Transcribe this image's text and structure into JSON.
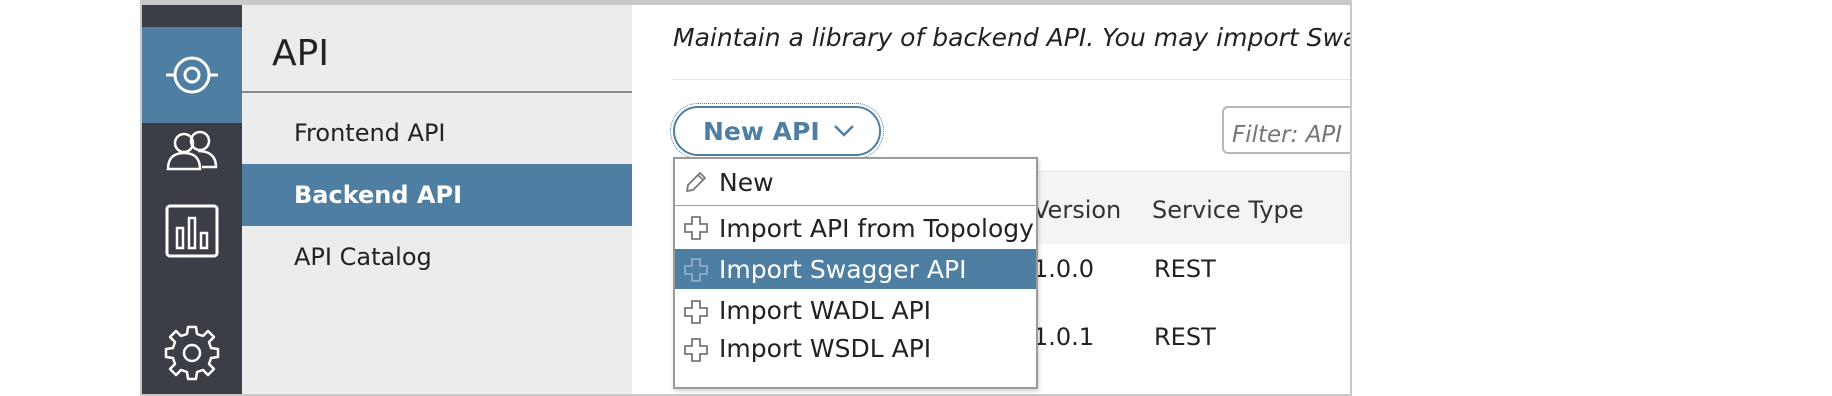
{
  "rail": {
    "items": [
      {
        "icon": "target-icon",
        "active": true
      },
      {
        "icon": "users-icon",
        "active": false
      },
      {
        "icon": "bar-chart-icon",
        "active": false
      },
      {
        "icon": "gear-icon",
        "active": false
      }
    ]
  },
  "subnav": {
    "title": "API",
    "items": [
      {
        "label": "Frontend API",
        "active": false
      },
      {
        "label": "Backend API",
        "active": true
      },
      {
        "label": "API Catalog",
        "active": false
      }
    ]
  },
  "main": {
    "description": "Maintain a library of backend API. You may import Swagger",
    "new_api_label": "New API",
    "filter_placeholder": "Filter: API",
    "table": {
      "headers": {
        "version": "Version",
        "service_type": "Service Type"
      },
      "rows": [
        {
          "version": "1.0.0",
          "service_type": "REST"
        },
        {
          "version": "1.0.1",
          "service_type": "REST"
        }
      ]
    },
    "dropdown": {
      "items": [
        {
          "label": "New",
          "icon": "pencil-icon",
          "selected": false
        },
        {
          "label": "Import API from Topology",
          "icon": "plus-icon",
          "selected": false
        },
        {
          "label": "Import Swagger API",
          "icon": "plus-icon",
          "selected": true
        },
        {
          "label": "Import WADL API",
          "icon": "plus-icon",
          "selected": false
        },
        {
          "label": "Import WSDL API",
          "icon": "plus-icon",
          "selected": false
        }
      ]
    }
  },
  "colors": {
    "rail_bg": "#3b3d47",
    "accent": "#4f7ea3",
    "subnav_bg": "#ececec"
  }
}
